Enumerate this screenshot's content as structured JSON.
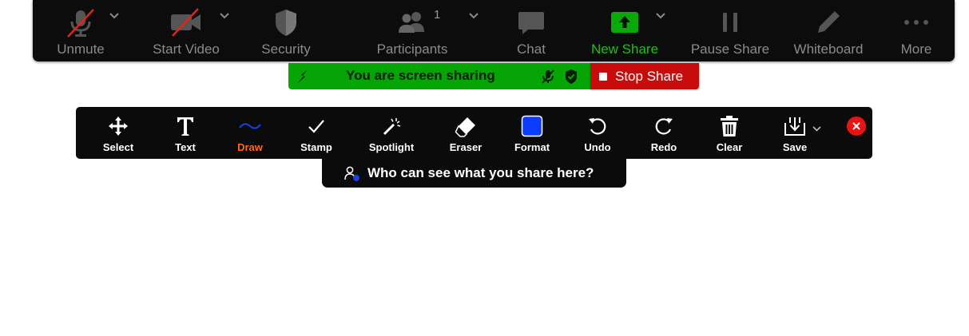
{
  "meeting_controls": {
    "unmute": "Unmute",
    "start_video": "Start Video",
    "security": "Security",
    "participants": "Participants",
    "participants_count": "1",
    "chat": "Chat",
    "new_share": "New Share",
    "pause_share": "Pause Share",
    "whiteboard": "Whiteboard",
    "more": "More"
  },
  "share_banner": {
    "text": "You are screen sharing",
    "stop_share": "Stop Share"
  },
  "annotation_tools": {
    "select": "Select",
    "text": "Text",
    "draw": "Draw",
    "stamp": "Stamp",
    "spotlight": "Spotlight",
    "eraser": "Eraser",
    "format": "Format",
    "undo": "Undo",
    "redo": "Redo",
    "clear": "Clear",
    "save": "Save"
  },
  "share_visibility": {
    "text": "Who can see what you share here?"
  },
  "colors": {
    "green_accent": "#21bd21",
    "stop_red": "#c80c0c",
    "draw_active": "#ff6a1a",
    "format_color": "#0b3dfb"
  }
}
